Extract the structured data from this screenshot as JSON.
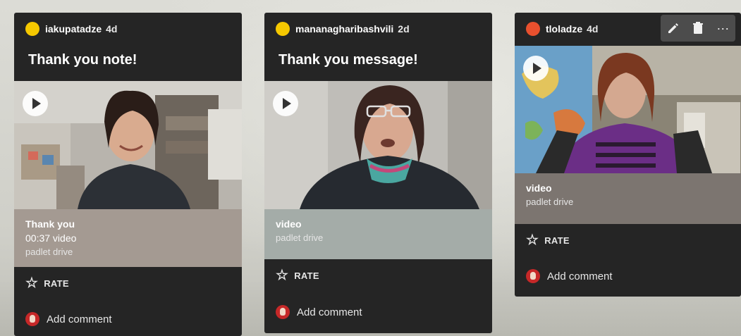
{
  "cards": [
    {
      "author": "iakupatadze",
      "age": "4d",
      "title": "Thank you note!",
      "avatar_color": "#f5c800",
      "meta_title": "Thank you",
      "meta_sub": "00:37 video",
      "meta_source": "padlet drive",
      "rate_label": "RATE",
      "comment_label": "Add comment"
    },
    {
      "author": "mananagharibashvili",
      "age": "2d",
      "title": "Thank you message!",
      "avatar_color": "#f5c800",
      "meta_title": "video",
      "meta_source": "padlet drive",
      "rate_label": "RATE",
      "comment_label": "Add comment"
    },
    {
      "author": "tloladze",
      "age": "4d",
      "avatar_color": "#e8502e",
      "meta_title": "video",
      "meta_source": "padlet drive",
      "rate_label": "RATE",
      "comment_label": "Add comment"
    }
  ],
  "toolbar": {
    "icons": [
      "pencil-icon",
      "trash-icon",
      "more-icon"
    ],
    "more_label": "···"
  }
}
